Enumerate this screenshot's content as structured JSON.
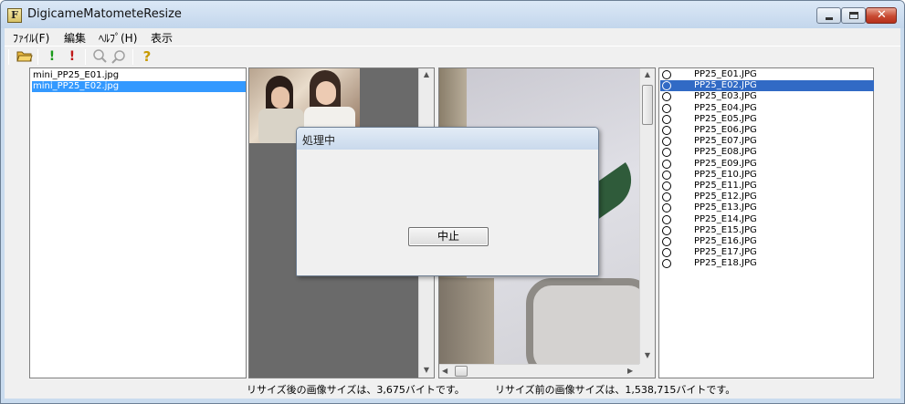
{
  "window": {
    "title": "DigicameMatometeResize",
    "icon_letter": "F"
  },
  "menu": [
    "ﾌｧｲﾙ(F)",
    "編集",
    "ﾍﾙﾌﾟ(H)",
    "表示"
  ],
  "toolbar": {
    "icons": [
      "open-folder-icon",
      "green-exclamation-icon",
      "red-exclamation-icon",
      "zoom-in-icon",
      "zoom-out-icon",
      "help-icon"
    ]
  },
  "left_list": {
    "items": [
      "mini_PP25_E01.jpg",
      "mini_PP25_E02.jpg"
    ],
    "selected_index": 1
  },
  "right_list": {
    "items": [
      "PP25_E01.JPG",
      "PP25_E02.JPG",
      "PP25_E03.JPG",
      "PP25_E04.JPG",
      "PP25_E05.JPG",
      "PP25_E06.JPG",
      "PP25_E07.JPG",
      "PP25_E08.JPG",
      "PP25_E09.JPG",
      "PP25_E10.JPG",
      "PP25_E11.JPG",
      "PP25_E12.JPG",
      "PP25_E13.JPG",
      "PP25_E14.JPG",
      "PP25_E15.JPG",
      "PP25_E16.JPG",
      "PP25_E17.JPG",
      "PP25_E18.JPG"
    ],
    "selected_index": 1
  },
  "status": {
    "after": "リサイズ後の画像サイズは、3,675バイトです。",
    "before": "リサイズ前の画像サイズは、1,538,715バイトです。"
  },
  "dialog": {
    "title": "処理中",
    "abort_label": "中止"
  },
  "colors": {
    "selection_left": "#3399ff",
    "selection_right": "#316ac5",
    "thumb_pane_bg": "#6a6a6a"
  }
}
